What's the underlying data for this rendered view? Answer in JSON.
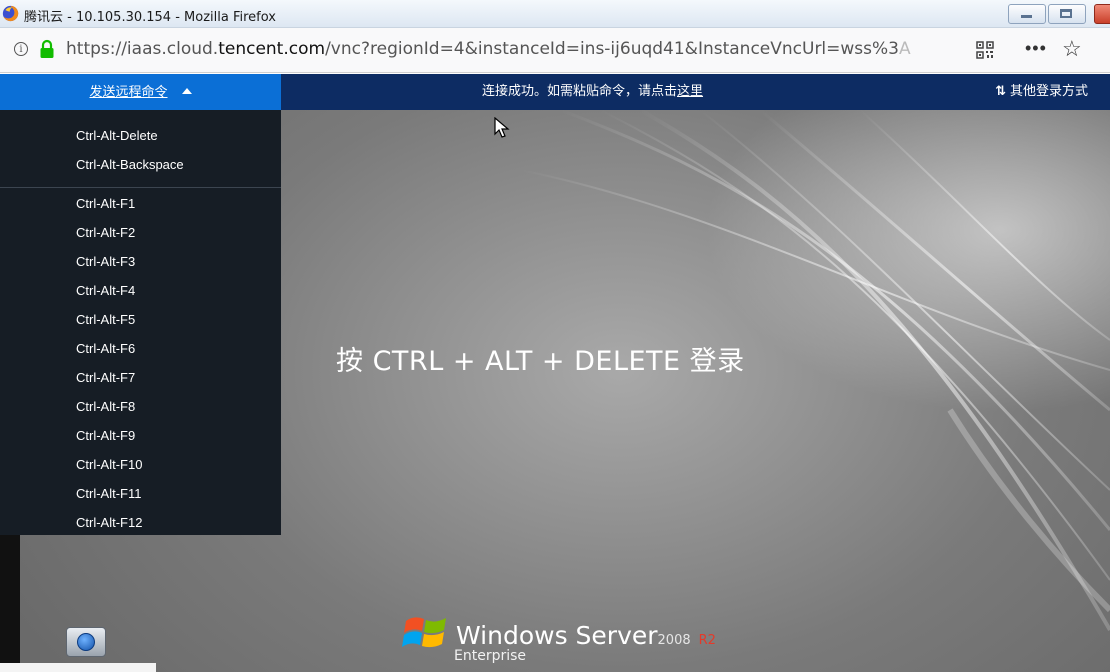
{
  "browser": {
    "window_title": "腾讯云 - 10.105.30.154 - Mozilla Firefox",
    "url_prefix": "https://iaas.cloud.",
    "url_domain": "tencent.com",
    "url_rest": "/vnc?regionId=4&instanceId=ins-ij6uqd41&InstanceVncUrl=wss%3",
    "url_fade": "A"
  },
  "vnc_bar": {
    "send_command_label": "发送远程命令",
    "notice_prefix": "连接成功。如需粘贴命令，请点击",
    "notice_link": "这里",
    "other_login_label": "其他登录方式"
  },
  "command_menu": {
    "items": [
      "Ctrl-Alt-Delete",
      "Ctrl-Alt-Backspace",
      "Ctrl-Alt-F1",
      "Ctrl-Alt-F2",
      "Ctrl-Alt-F3",
      "Ctrl-Alt-F4",
      "Ctrl-Alt-F5",
      "Ctrl-Alt-F6",
      "Ctrl-Alt-F7",
      "Ctrl-Alt-F8",
      "Ctrl-Alt-F9",
      "Ctrl-Alt-F10",
      "Ctrl-Alt-F11",
      "Ctrl-Alt-F12"
    ]
  },
  "remote_screen": {
    "login_prompt": "按 CTRL + ALT + DELETE 登录",
    "brand_name": "Windows Server",
    "brand_year": "2008",
    "brand_release": "R2",
    "brand_edition": "Enterprise"
  },
  "colors": {
    "vnc_bar_bg": "#0d2c63",
    "send_command_bg": "#0b6fd6",
    "menu_bg": "#161d25"
  }
}
